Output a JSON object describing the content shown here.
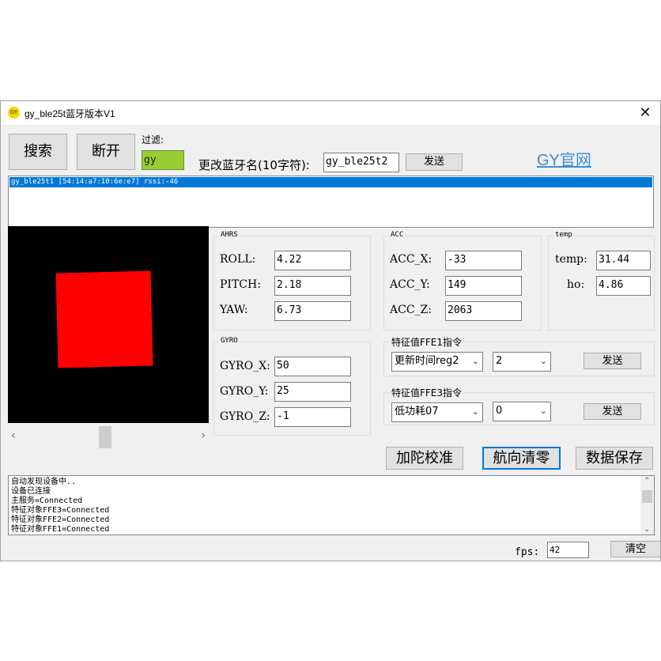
{
  "window": {
    "title": "gy_ble25t蓝牙版本V1",
    "app_icon": "GY",
    "close_icon": "✕"
  },
  "toolbar": {
    "search_label": "搜索",
    "disconnect_label": "断开",
    "filter_label": "过滤:",
    "filter_value": "gy",
    "rename_label": "更改蓝牙名(10字符):",
    "rename_value": "gy_ble25t2",
    "send_label": "发送",
    "official_link": "GY官网"
  },
  "devices": {
    "items": [
      "gy_ble25t1 [54:14:a7:10:6e:e7] rssi:-46"
    ]
  },
  "ahrs": {
    "title": "AHRS",
    "roll_label": "ROLL:",
    "roll_value": "4.22",
    "pitch_label": "PITCH:",
    "pitch_value": "2.18",
    "yaw_label": "YAW:",
    "yaw_value": "6.73"
  },
  "acc": {
    "title": "ACC",
    "x_label": "ACC_X:",
    "x_value": "-33",
    "y_label": "ACC_Y:",
    "y_value": "149",
    "z_label": "ACC_Z:",
    "z_value": "2063"
  },
  "temp": {
    "title": "temp",
    "temp_label": "temp:",
    "temp_value": "31.44",
    "ho_label": "ho:",
    "ho_value": "4.86"
  },
  "gyro": {
    "title": "GYRO",
    "x_label": "GYRO_X:",
    "x_value": "50",
    "y_label": "GYRO_Y:",
    "y_value": "25",
    "z_label": "GYRO_Z:",
    "z_value": "-1"
  },
  "ffe1": {
    "title": "特征值FFE1指令",
    "mode_value": "更新时间reg2",
    "num_value": "2",
    "send_label": "发送"
  },
  "ffe3": {
    "title": "特征值FFE3指令",
    "mode_value": "低功耗07",
    "num_value": "0",
    "send_label": "发送"
  },
  "actions": {
    "calibrate_label": "加陀校准",
    "heading_zero_label": "航向清零",
    "save_label": "数据保存"
  },
  "log": {
    "lines": [
      "自动发现设备中..",
      "设备已连接",
      "主服务=Connected",
      "特征对象FFE3=Connected",
      "特征对象FFE2=Connected",
      "特征对象FFE1=Connected"
    ]
  },
  "footer": {
    "fps_label": "fps:",
    "fps_value": "42",
    "clear_label": "清空"
  },
  "colors": {
    "accent": "#0078d7",
    "filter_bg": "#9acd32",
    "cube": "#ff0000",
    "link": "#3b8fd6"
  }
}
